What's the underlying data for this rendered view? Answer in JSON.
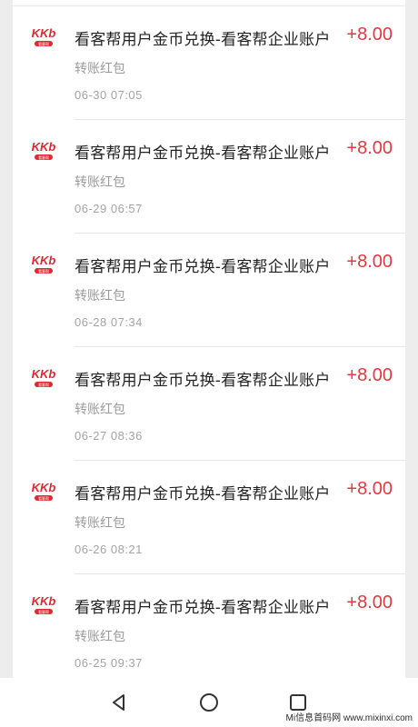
{
  "transactions": [
    {
      "title": "看客帮用户金币兑换-看客帮企业账户",
      "subtitle": "转账红包",
      "time": "06-30 07:05",
      "amount": "+8.00"
    },
    {
      "title": "看客帮用户金币兑换-看客帮企业账户",
      "subtitle": "转账红包",
      "time": "06-29 06:57",
      "amount": "+8.00"
    },
    {
      "title": "看客帮用户金币兑换-看客帮企业账户",
      "subtitle": "转账红包",
      "time": "06-28 07:34",
      "amount": "+8.00"
    },
    {
      "title": "看客帮用户金币兑换-看客帮企业账户",
      "subtitle": "转账红包",
      "time": "06-27 08:36",
      "amount": "+8.00"
    },
    {
      "title": "看客帮用户金币兑换-看客帮企业账户",
      "subtitle": "转账红包",
      "time": "06-26 08:21",
      "amount": "+8.00"
    },
    {
      "title": "看客帮用户金币兑换-看客帮企业账户",
      "subtitle": "转账红包",
      "time": "06-25 09:37",
      "amount": "+8.00"
    }
  ],
  "logo": {
    "text": "KKb",
    "tagline": "看客帮",
    "color": "#e0282e"
  },
  "colors": {
    "amount": "#e6373f",
    "title": "#222222",
    "muted": "#9a9a9a"
  },
  "navbar": {
    "icons": [
      "back-triangle-icon",
      "home-circle-icon",
      "recents-square-icon"
    ]
  },
  "watermark": "Mi信息首码网 www.mixinxi.com"
}
